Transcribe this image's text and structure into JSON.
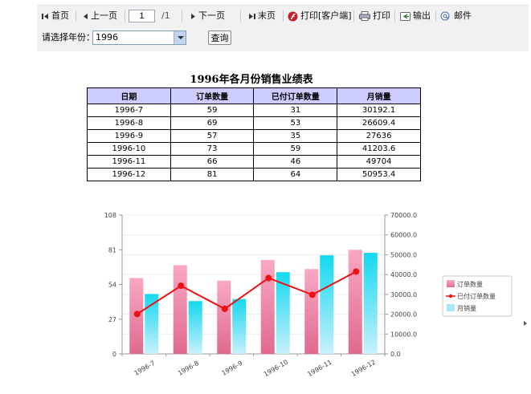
{
  "toolbar": {
    "first_label": "首页",
    "prev_label": "上一页",
    "page_value": "1",
    "page_total": "/1",
    "next_label": "下一页",
    "last_label": "末页",
    "print_client_label": "打印[客户端]",
    "print_label": "打印",
    "export_label": "输出",
    "email_label": "邮件"
  },
  "filter": {
    "year_label": "请选择年份：",
    "year_value": "1996",
    "query_label": "查询"
  },
  "report": {
    "title": "1996年各月份销售业绩表",
    "headers": [
      "日期",
      "订单数量",
      "已付订单数量",
      "月销量"
    ],
    "rows": [
      [
        "1996-7",
        "59",
        "31",
        "30192.1"
      ],
      [
        "1996-8",
        "69",
        "53",
        "26609.4"
      ],
      [
        "1996-9",
        "57",
        "35",
        "27636"
      ],
      [
        "1996-10",
        "73",
        "59",
        "41203.6"
      ],
      [
        "1996-11",
        "66",
        "46",
        "49704"
      ],
      [
        "1996-12",
        "81",
        "64",
        "50953.4"
      ]
    ]
  },
  "chart_data": {
    "type": "bar",
    "categories": [
      "1996-7",
      "1996-8",
      "1996-9",
      "1996-10",
      "1996-11",
      "1996-12"
    ],
    "series": [
      {
        "name": "订单数量",
        "kind": "bar",
        "axis": "left",
        "color": "#ee7fa0",
        "values": [
          59,
          69,
          57,
          73,
          66,
          81
        ]
      },
      {
        "name": "已付订单数量",
        "kind": "line",
        "axis": "left",
        "color": "#ee1111",
        "values": [
          31,
          53,
          35,
          59,
          46,
          64
        ]
      },
      {
        "name": "月销量",
        "kind": "bar",
        "axis": "right",
        "color": "#22d6ee",
        "values": [
          30192.1,
          26609.4,
          27636,
          41203.6,
          49704,
          50953.4
        ]
      }
    ],
    "left_axis": {
      "ticks": [
        "0",
        "27",
        "54",
        "81",
        "108"
      ],
      "range": [
        0,
        108
      ]
    },
    "right_axis": {
      "ticks": [
        "0.0",
        "10000.0",
        "20000.0",
        "30000.0",
        "40000.0",
        "50000.0",
        "60000.0",
        "70000.0"
      ],
      "range": [
        0,
        70000
      ]
    },
    "legend_position": "right",
    "grid": true
  }
}
